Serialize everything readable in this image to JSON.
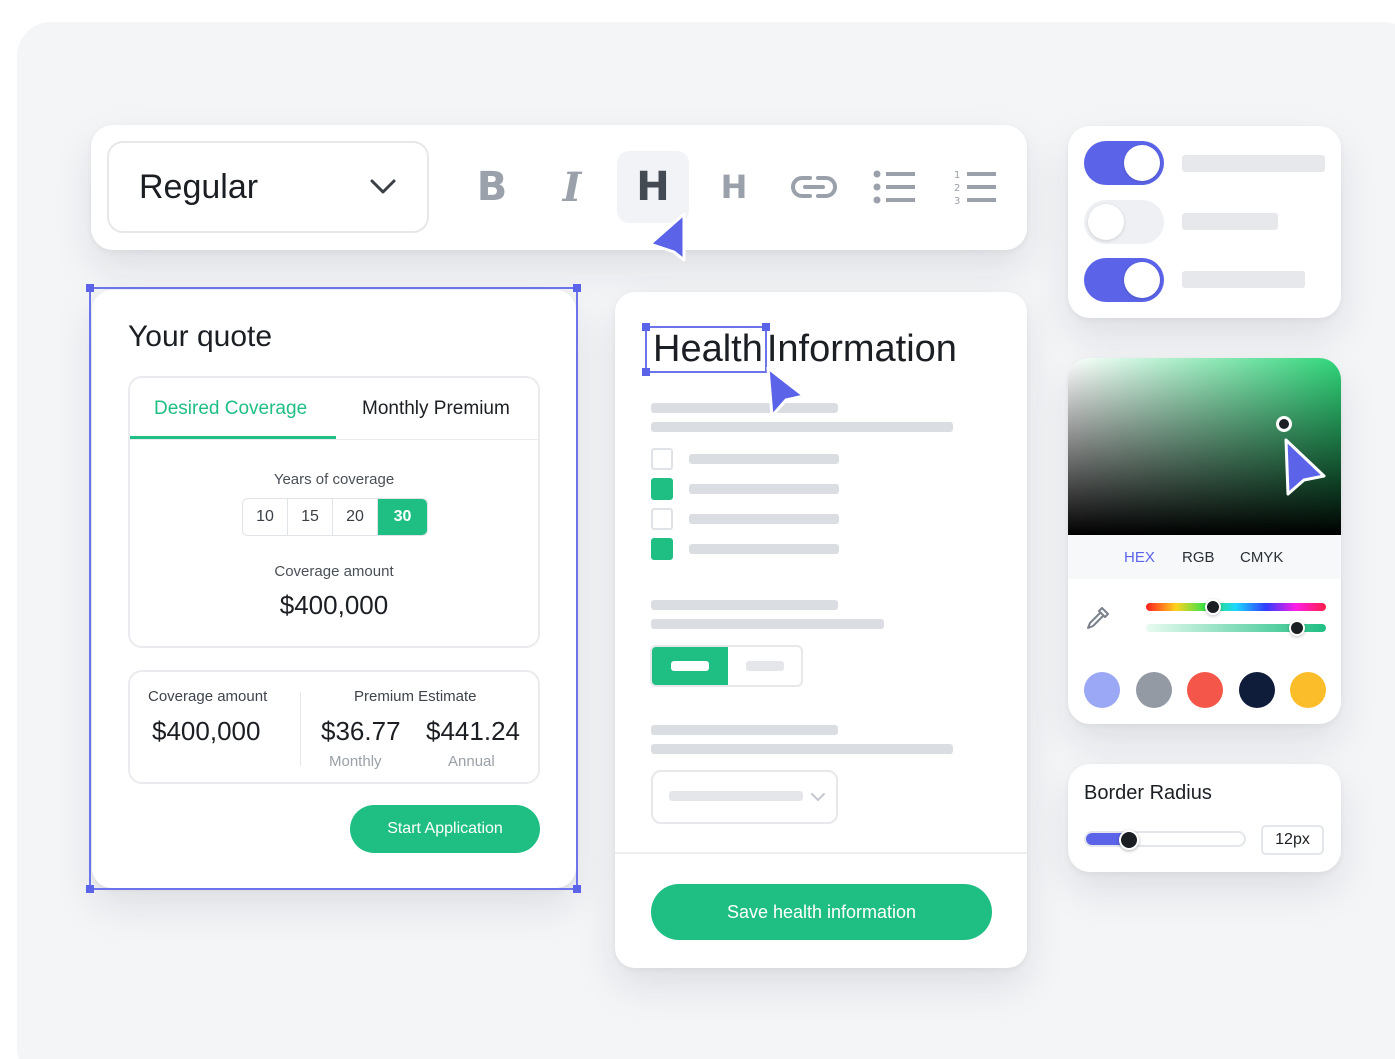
{
  "toolbar": {
    "font_style": "Regular",
    "tools": [
      {
        "name": "bold",
        "glyph": "B"
      },
      {
        "name": "italic",
        "glyph": "I"
      },
      {
        "name": "heading-1",
        "glyph": "H"
      },
      {
        "name": "heading-2",
        "glyph": "H"
      },
      {
        "name": "link",
        "glyph": ""
      },
      {
        "name": "bullet-list",
        "glyph": ""
      },
      {
        "name": "numbered-list",
        "glyph": ""
      }
    ],
    "active_tool": "heading-1"
  },
  "quote": {
    "title": "Your quote",
    "tabs": [
      "Desired Coverage",
      "Monthly Premium"
    ],
    "active_tab": "Desired Coverage",
    "years_label": "Years of coverage",
    "years": [
      "10",
      "15",
      "20",
      "30"
    ],
    "selected_year": "30",
    "coverage_label": "Coverage amount",
    "coverage_amount": "$400,000",
    "summary": {
      "coverage_label": "Coverage amount",
      "coverage_value": "$400,000",
      "premium_label": "Premium Estimate",
      "monthly_value": "$36.77",
      "monthly_label": "Monthly",
      "annual_value": "$441.24",
      "annual_label": "Annual"
    },
    "start_button": "Start Application"
  },
  "health": {
    "title_word_1": "Health",
    "title_word_2": "Information",
    "checkboxes": [
      false,
      true,
      false,
      true
    ],
    "save_button": "Save health information"
  },
  "toggles": [
    true,
    false,
    true
  ],
  "color_picker": {
    "modes": [
      "HEX",
      "RGB",
      "CMYK"
    ],
    "active_mode": "HEX",
    "hue_position": 0.37,
    "alpha_position": 0.84,
    "swatches": [
      "#9aa8f5",
      "#939aa4",
      "#f4574a",
      "#0f1d3b",
      "#fbbd2a"
    ]
  },
  "border_radius": {
    "title": "Border Radius",
    "value": "12px",
    "slider_position": 0.28
  },
  "colors": {
    "accent": "#5b64e8",
    "brand_green": "#1fbf83"
  }
}
